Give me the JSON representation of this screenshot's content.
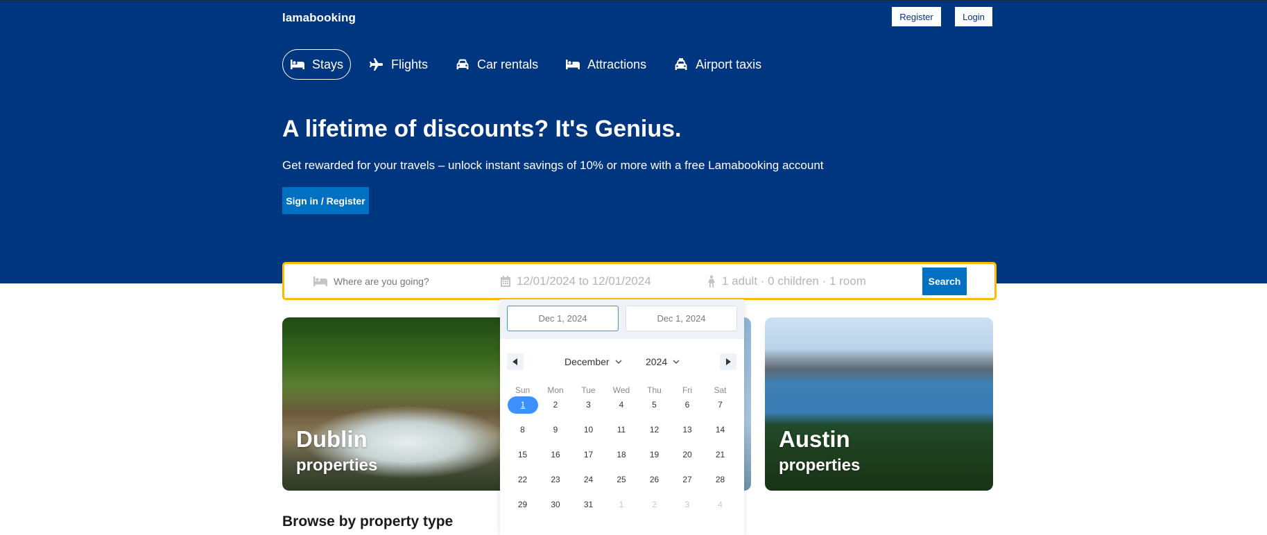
{
  "header": {
    "logo": "lamabooking",
    "register_label": "Register",
    "login_label": "Login"
  },
  "nav": {
    "items": [
      {
        "label": "Stays",
        "icon": "bed-icon",
        "active": true
      },
      {
        "label": "Flights",
        "icon": "plane-icon"
      },
      {
        "label": "Car rentals",
        "icon": "car-icon"
      },
      {
        "label": "Attractions",
        "icon": "bed-icon"
      },
      {
        "label": "Airport taxis",
        "icon": "taxi-icon"
      }
    ]
  },
  "hero": {
    "title": "A lifetime of discounts? It's Genius.",
    "subtitle": "Get rewarded for your travels – unlock instant savings of 10% or more with a free Lamabooking account",
    "cta_label": "Sign in / Register"
  },
  "search": {
    "destination_placeholder": "Where are you going?",
    "dates_text": "12/01/2024 to 12/01/2024",
    "occupancy_text": "1 adult · 0 children · 1 room",
    "search_label": "Search"
  },
  "datepicker": {
    "start_date": "Dec 1, 2024",
    "end_date": "Dec 1, 2024",
    "month": "December",
    "year": "2024",
    "weekdays": [
      "Sun",
      "Mon",
      "Tue",
      "Wed",
      "Thu",
      "Fri",
      "Sat"
    ],
    "weeks": [
      [
        "1",
        "2",
        "3",
        "4",
        "5",
        "6",
        "7"
      ],
      [
        "8",
        "9",
        "10",
        "11",
        "12",
        "13",
        "14"
      ],
      [
        "15",
        "16",
        "17",
        "18",
        "19",
        "20",
        "21"
      ],
      [
        "22",
        "23",
        "24",
        "25",
        "26",
        "27",
        "28"
      ],
      [
        "29",
        "30",
        "31",
        "1",
        "2",
        "3",
        "4"
      ]
    ],
    "selected_day": "1"
  },
  "featured": {
    "cards": [
      {
        "city": "Dublin",
        "sub": "properties"
      },
      {
        "city": "Austin",
        "sub": "properties"
      }
    ]
  },
  "sections": {
    "property_type_title": "Browse by property type"
  },
  "colors": {
    "brand_blue": "#003580",
    "action_blue": "#0071c2",
    "search_border": "#febb02",
    "selected_day": "#3d91ff"
  }
}
